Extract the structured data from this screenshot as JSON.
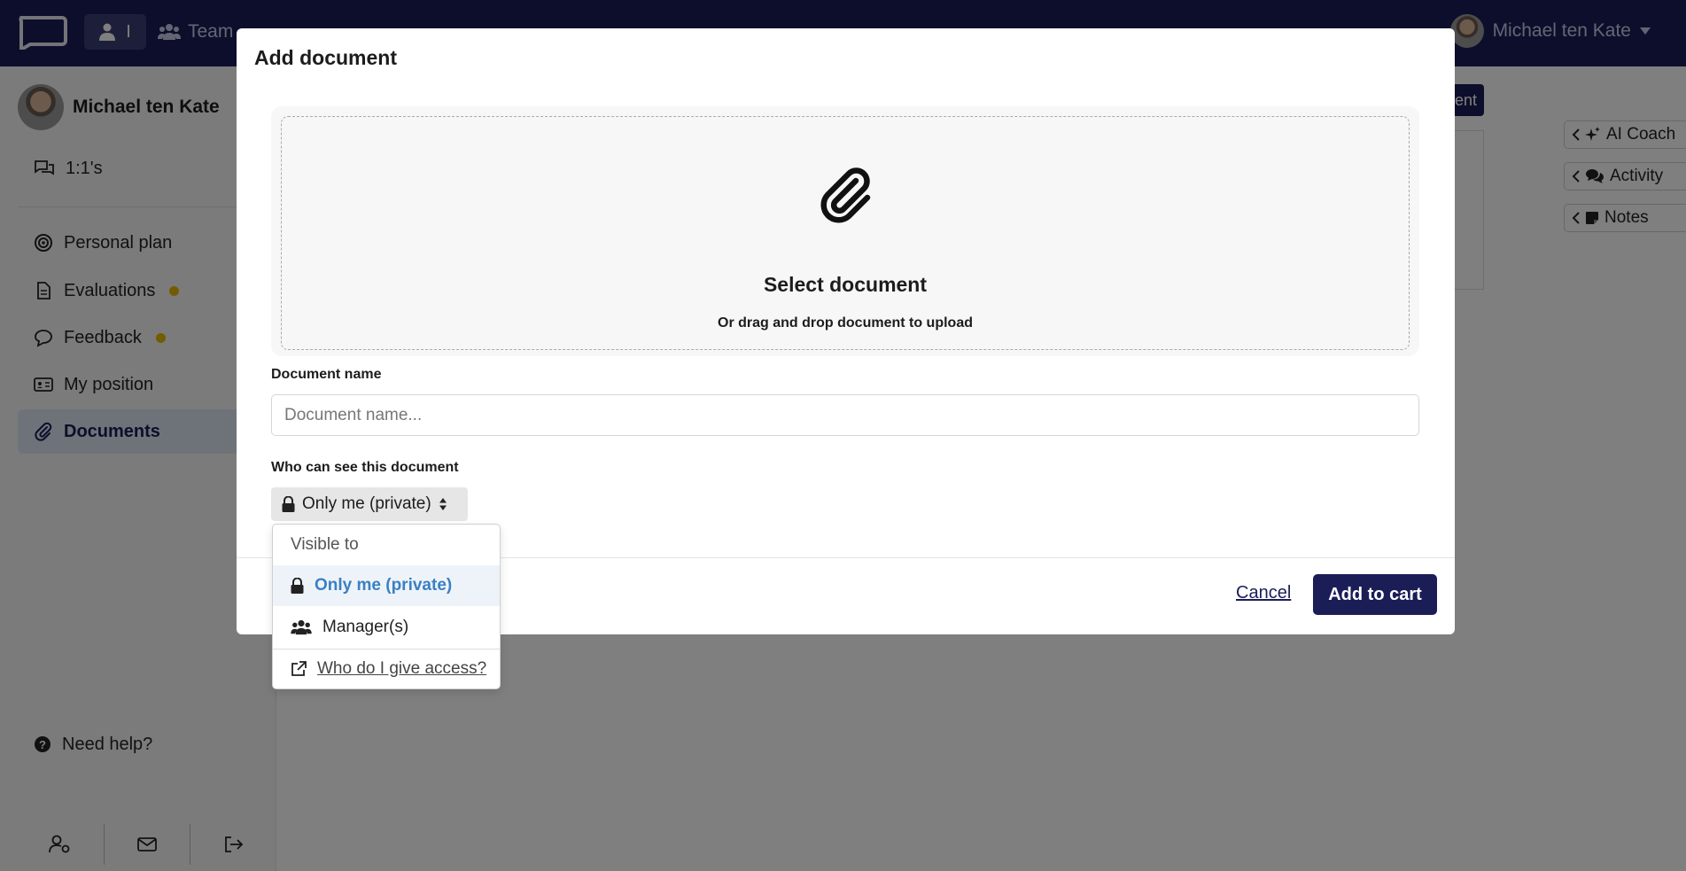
{
  "topbar": {
    "me_label": "I",
    "team_label": "Team",
    "user_name": "Michael ten Kate"
  },
  "sidebar": {
    "profile_name": "Michael ten Kate",
    "one_on_one": "1:1's",
    "items": [
      {
        "label": "Personal plan",
        "icon": "target-icon"
      },
      {
        "label": "Evaluations",
        "icon": "document-icon",
        "badge": true
      },
      {
        "label": "Feedback",
        "icon": "chat-icon",
        "badge": true,
        "expandable": true
      },
      {
        "label": "My position",
        "icon": "id-card-icon"
      },
      {
        "label": "Documents",
        "icon": "paperclip-icon",
        "active": true
      }
    ],
    "help_label": "Need help?"
  },
  "right_panel": {
    "ai_coach": "AI Coach",
    "activity": "Activity",
    "notes": "Notes",
    "partial_button": "ent"
  },
  "modal": {
    "title": "Add document",
    "drop_title": "Select document",
    "drop_subtitle": "Or drag and drop document to upload",
    "name_label": "Document name",
    "name_placeholder": "Document name...",
    "name_value": "",
    "visibility_label": "Who can see this document",
    "visibility_value": "Only me (private)",
    "cancel_label": "Cancel",
    "submit_label": "Add to cart"
  },
  "dropdown": {
    "header": "Visible to",
    "options": [
      {
        "label": "Only me (private)",
        "icon": "lock-icon",
        "selected": true
      },
      {
        "label": "Manager(s)",
        "icon": "users-icon",
        "selected": false
      }
    ],
    "help_link": "Who do I give access?"
  },
  "colors": {
    "brand_navy": "#1b1d57",
    "badge_yellow": "#e6b800",
    "selected_blue": "#3a80c3"
  }
}
